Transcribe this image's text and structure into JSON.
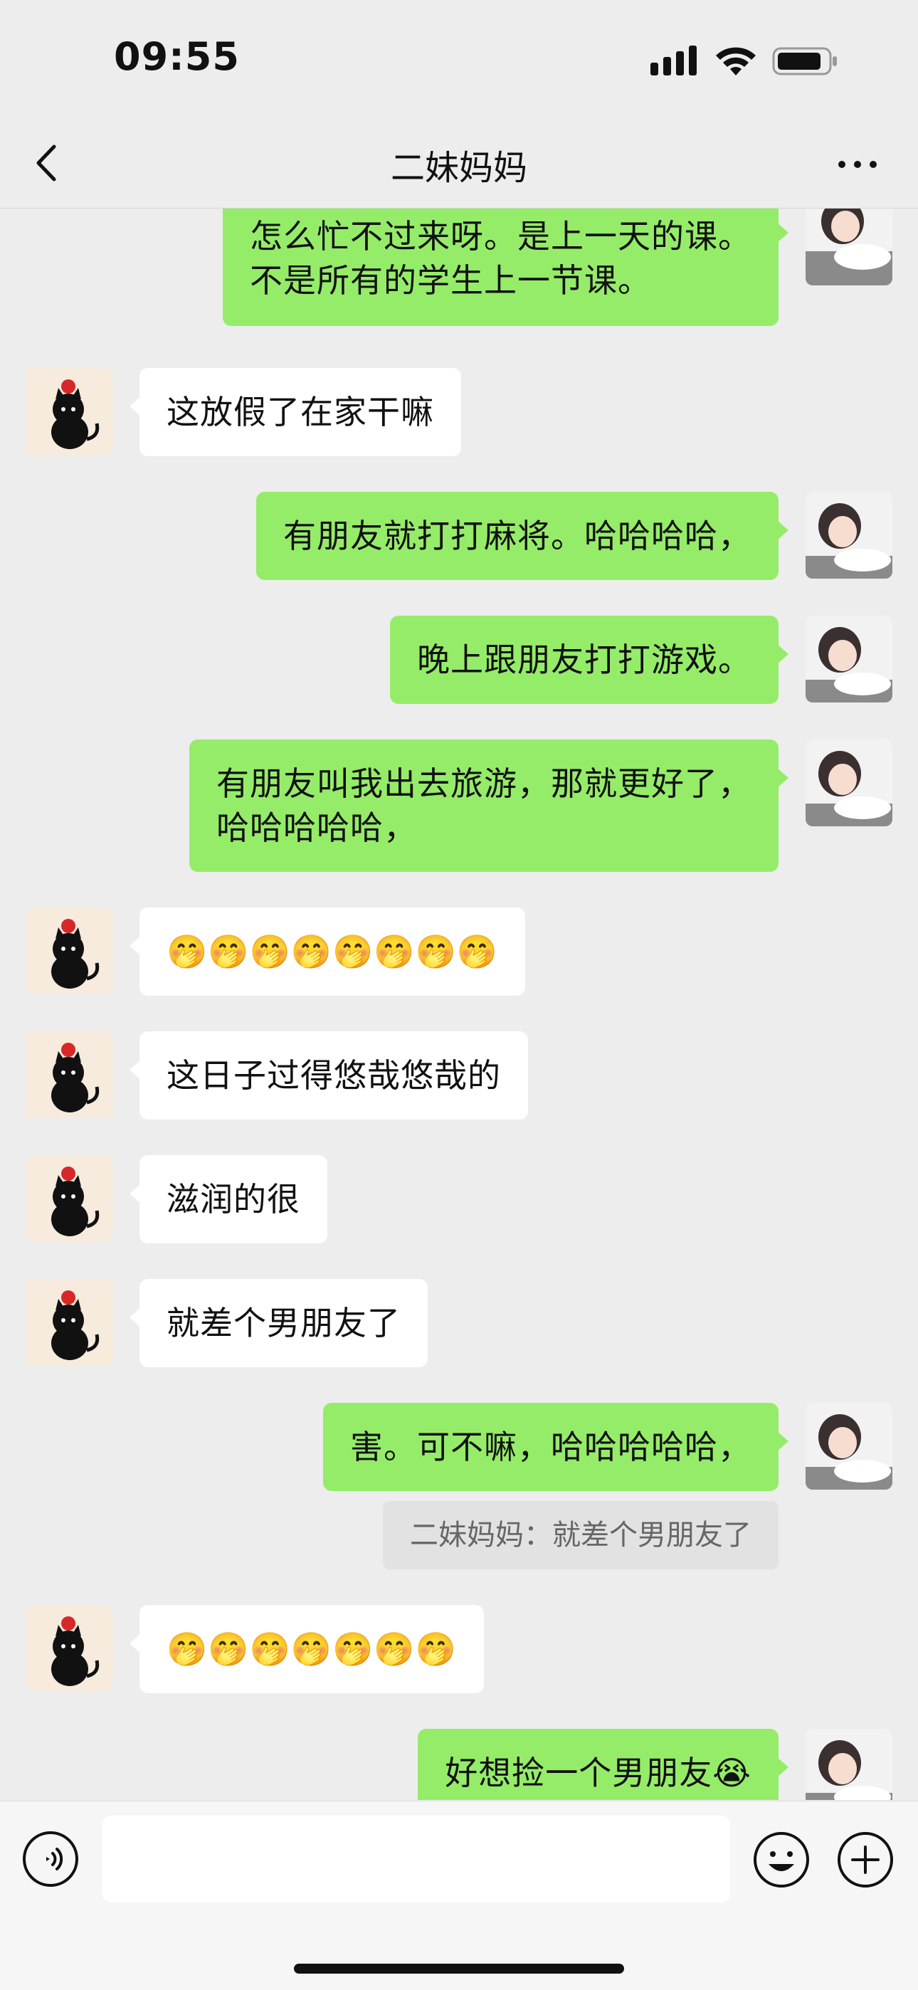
{
  "status_bar": {
    "time": "09:55"
  },
  "nav": {
    "title": "二妹妈妈"
  },
  "colors": {
    "background": "#ededed",
    "my_bubble": "#95ec69",
    "their_bubble": "#ffffff",
    "quote_bg": "#e2e2e2"
  },
  "messages": [
    {
      "side": "right",
      "text": "怎么忙不过来呀。是上一天的课。\n不是所有的学生上一节课。"
    },
    {
      "side": "left",
      "text": "这放假了在家干嘛"
    },
    {
      "side": "right",
      "text": "有朋友就打打麻将。哈哈哈哈，"
    },
    {
      "side": "right",
      "text": "晚上跟朋友打打游戏。"
    },
    {
      "side": "right",
      "text": "有朋友叫我出去旅游，那就更好了，\n哈哈哈哈哈，"
    },
    {
      "side": "left",
      "text": "🤭🤭🤭🤭🤭🤭🤭🤭"
    },
    {
      "side": "left",
      "text": "这日子过得悠哉悠哉的"
    },
    {
      "side": "left",
      "text": "滋润的很"
    },
    {
      "side": "left",
      "text": "就差个男朋友了"
    },
    {
      "side": "right",
      "text": "害。可不嘛，哈哈哈哈哈，"
    },
    {
      "side": "left",
      "text": "🤭🤭🤭🤭🤭🤭🤭"
    },
    {
      "side": "right",
      "text": "好想捡一个男朋友😭"
    }
  ],
  "quote": {
    "text": "二妹妈妈：就差个男朋友了"
  },
  "input": {
    "value": "",
    "placeholder": ""
  },
  "icons": {
    "back": "chevron-left-icon",
    "more": "more-dots-icon",
    "voice": "voice-icon",
    "emoji": "emoji-icon",
    "add": "add-icon",
    "contact_avatar": "black-cat-avatar",
    "my_avatar": "girl-avatar"
  }
}
